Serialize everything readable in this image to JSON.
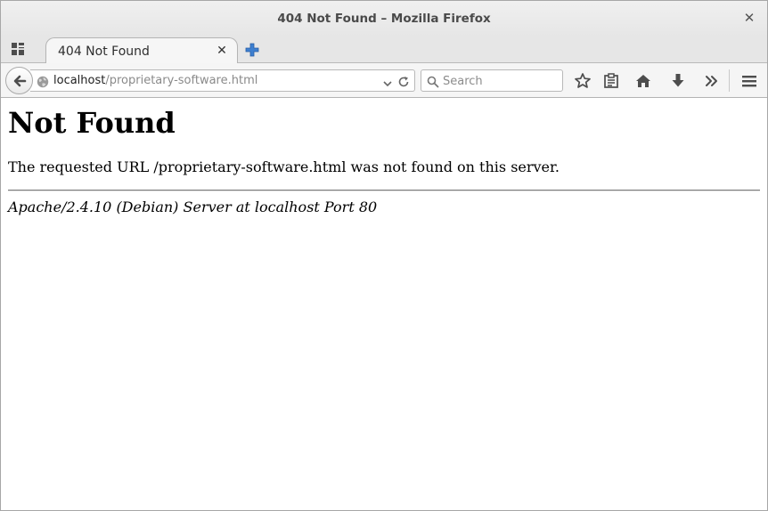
{
  "window": {
    "title": "404 Not Found – Mozilla Firefox",
    "close_glyph": "✕"
  },
  "tabs": [
    {
      "label": "404 Not Found",
      "close_glyph": "✕",
      "active": true
    }
  ],
  "navbar": {
    "url_host": "localhost",
    "url_path": "/proprietary-software.html",
    "search_placeholder": "Search"
  },
  "page": {
    "heading": "Not Found",
    "message": "The requested URL /proprietary-software.html was not found on this server.",
    "server_signature": "Apache/2.4.10 (Debian) Server at localhost Port 80"
  },
  "colors": {
    "new_tab_plus": "#3d7fd0",
    "icon_gray": "#4d4d4d"
  },
  "icons": [
    "tabs-grid-icon",
    "plus-icon",
    "back-arrow-icon",
    "globe-icon",
    "chevron-down-icon",
    "reload-icon",
    "search-icon",
    "star-icon",
    "reading-list-icon",
    "home-icon",
    "download-arrow-icon",
    "overflow-chevrons-icon",
    "hamburger-menu-icon"
  ]
}
